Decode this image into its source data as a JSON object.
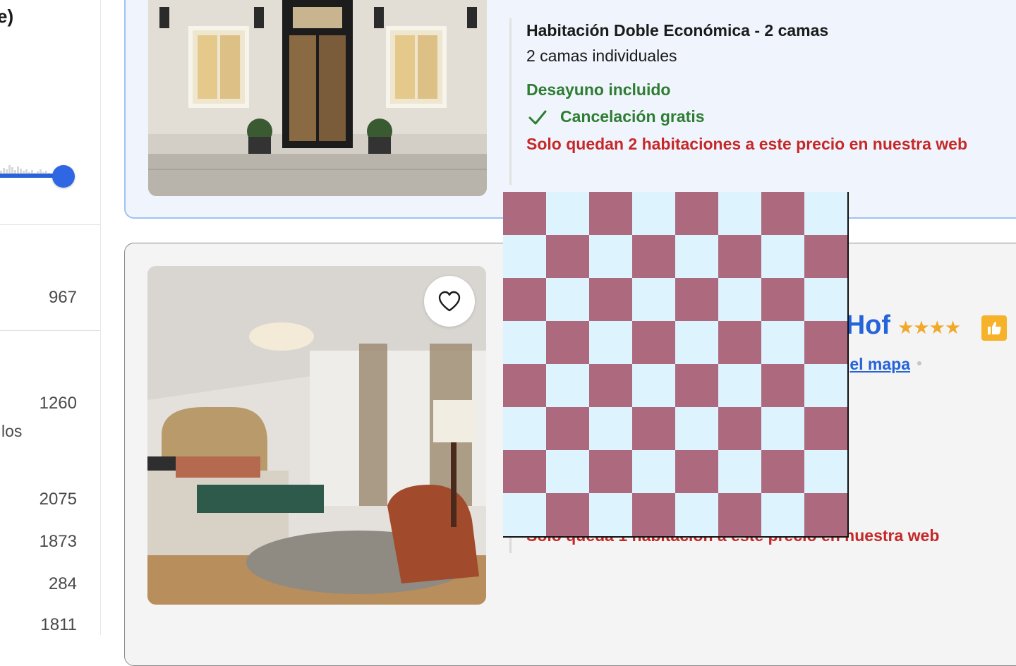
{
  "sidebar": {
    "heading_fragment": "e)",
    "label_fragment": "los",
    "counts": [
      "967",
      "1260",
      "2075",
      "1873",
      "284",
      "1811"
    ]
  },
  "hotel1": {
    "room_title": "Habitación Doble Económica - 2 camas",
    "beds": "2 camas individuales",
    "breakfast": "Desayuno incluido",
    "cancellation": "Cancelación gratis",
    "scarcity": "Solo quedan 2 habitaciones a este precio en nuestra web"
  },
  "hotel2": {
    "name_fragment": "Hof",
    "stars": "★★★★",
    "map_link_fragment": "el mapa",
    "scarcity": "Solo queda 1 habitación a este precio en nuestra web"
  },
  "icons": {
    "favorite": "heart-icon",
    "check": "check-icon",
    "thumbs": "thumbs-up-icon"
  },
  "colors": {
    "link_blue": "#2563d9",
    "perk_green": "#2e7d32",
    "scarcity_red": "#c62828",
    "highlight_bg": "#f0f5fd",
    "checker_a": "#ad6a7e",
    "checker_b": "#ddf3fd"
  }
}
